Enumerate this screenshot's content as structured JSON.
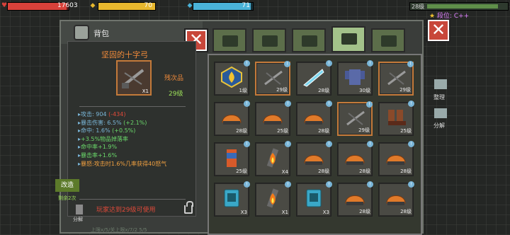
{
  "hud": {
    "hp_value": "17603",
    "hp_fill": 0.96,
    "armor_value": "70",
    "armor_fill": 1.0,
    "mp_value": "71",
    "mp_fill": 0.97,
    "level_label": "28级",
    "rank_label": "段位: C++"
  },
  "bag": {
    "title": "背包"
  },
  "detail": {
    "item_name": "坚固的十字弓",
    "quality": "残次品",
    "level": "29级",
    "stack": "X1",
    "stats": [
      {
        "label": "攻击: 904 ",
        "extra": "(-434)",
        "extra_kind": "neg"
      },
      {
        "label": "暴击伤害: 6.5% ",
        "extra": "(+2.1%)",
        "extra_kind": "pos"
      },
      {
        "label": "命中: 1.6% ",
        "extra": "(+0.5%)",
        "extra_kind": "pos"
      },
      {
        "label": "+3.5%物品掉落率",
        "extra": "",
        "extra_kind": ""
      },
      {
        "label": "命中率+1.9%",
        "extra": "",
        "extra_kind": ""
      },
      {
        "label": "暴击率+1.6%",
        "extra": "",
        "extra_kind": ""
      },
      {
        "label": "暴怒:攻击时1.6%几率获得40怒气",
        "extra": "",
        "extra_kind": "orange"
      }
    ],
    "requirement": "玩家达到29级可使用",
    "modify_button": "改造",
    "remaining": "剩余2次",
    "split_label": "分解"
  },
  "side": {
    "sort_label": "整理",
    "split_label": "分解"
  },
  "slots": [
    {
      "lvl": "1级",
      "kind": "emblem"
    },
    {
      "lvl": "29级",
      "kind": "crossbow"
    },
    {
      "lvl": "28级",
      "kind": "blade"
    },
    {
      "lvl": "30级",
      "kind": "armor"
    },
    {
      "lvl": "29级",
      "kind": "crossbow"
    },
    {
      "lvl": "28级",
      "kind": "helmet"
    },
    {
      "lvl": "25级",
      "kind": "helmet"
    },
    {
      "lvl": "28级",
      "kind": "helmet"
    },
    {
      "lvl": "29级",
      "kind": "crossbow"
    },
    {
      "lvl": "25级",
      "kind": "boots"
    },
    {
      "lvl": "25级",
      "kind": "can"
    },
    {
      "lvl": "X4",
      "kind": "fire"
    },
    {
      "lvl": "28级",
      "kind": "helmet"
    },
    {
      "lvl": "28级",
      "kind": "helmet"
    },
    {
      "lvl": "28级",
      "kind": "helmet"
    },
    {
      "lvl": "X3",
      "kind": "tablet"
    },
    {
      "lvl": "X1",
      "kind": "fire"
    },
    {
      "lvl": "X3",
      "kind": "tablet"
    },
    {
      "lvl": "28级",
      "kind": "helmet"
    },
    {
      "lvl": "28级",
      "kind": "helmet"
    }
  ],
  "tabs": [
    "backpack-tab",
    "medkit-tab",
    "equipment-tab",
    "weapon-tab",
    "gear-tab"
  ],
  "bottom_hint": "上限x/5/关上限x/7/2 5/5"
}
